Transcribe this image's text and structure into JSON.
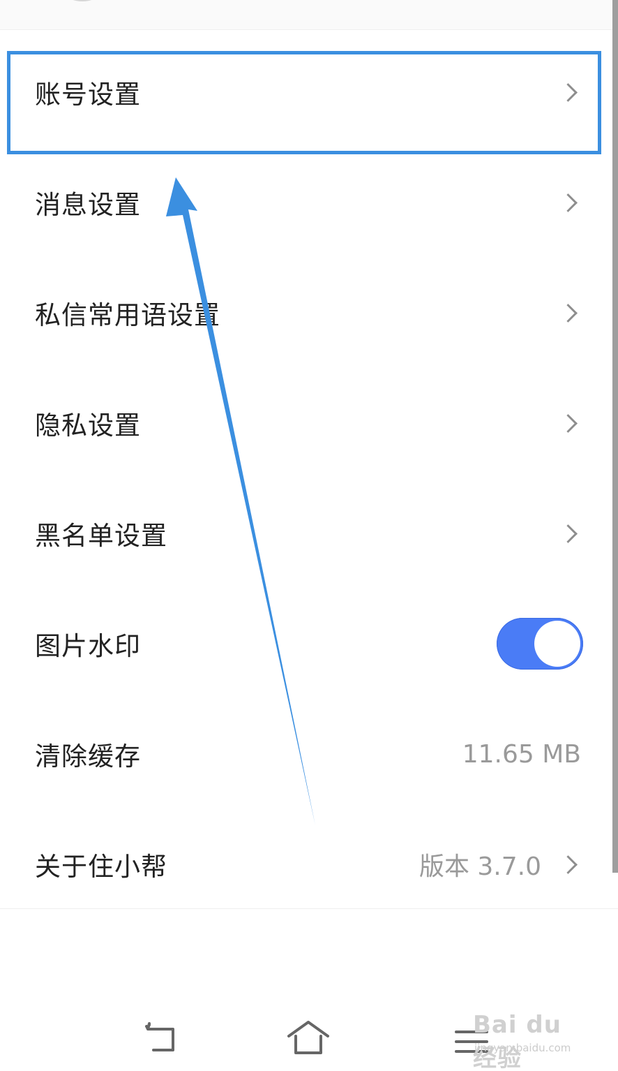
{
  "settings": {
    "items": [
      {
        "label": "账号设置",
        "has_chevron": true
      },
      {
        "label": "消息设置",
        "has_chevron": true
      },
      {
        "label": "私信常用语设置",
        "has_chevron": true
      },
      {
        "label": "隐私设置",
        "has_chevron": true
      },
      {
        "label": "黑名单设置",
        "has_chevron": true
      },
      {
        "label": "图片水印",
        "toggle": "on"
      },
      {
        "label": "清除缓存",
        "value": "11.65 MB"
      },
      {
        "label": "关于住小帮",
        "value": "版本 3.7.0",
        "has_chevron": true
      }
    ]
  },
  "icons": {
    "chevron": "chevron-right-icon",
    "back": "back-icon",
    "home": "home-icon",
    "menu": "menu-icon"
  },
  "colors": {
    "accent": "#4a7cf6",
    "highlight": "#3b8fe0",
    "arrow": "#3b8fe0"
  },
  "watermark": {
    "brand": "Bai du 经验",
    "url": "jingyan.baidu.com"
  }
}
